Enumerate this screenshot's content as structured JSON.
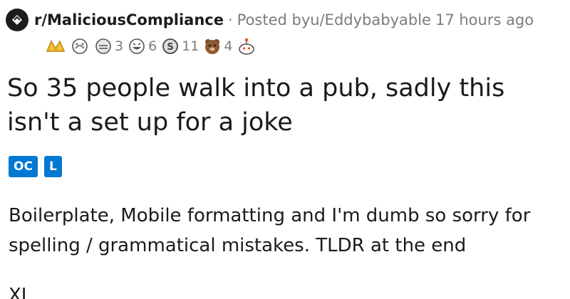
{
  "header": {
    "subreddit": "r/MaliciousCompliance",
    "separator": "·",
    "posted_by": "Posted by ",
    "author": "u/Eddybabyable",
    "time": "17 hours ago"
  },
  "awards": [
    {
      "icon": "gold-wings-award",
      "count": ""
    },
    {
      "icon": "wholesome-hug-award",
      "count": ""
    },
    {
      "icon": "hug-award",
      "count": "3"
    },
    {
      "icon": "laughing-face-award",
      "count": "6"
    },
    {
      "icon": "silver-coin-award",
      "count": "11"
    },
    {
      "icon": "bear-award",
      "count": "4"
    },
    {
      "icon": "snoo-award",
      "count": ""
    }
  ],
  "post": {
    "title": "So 35 people walk into a pub, sadly this isn't a set up for a joke",
    "flairs": [
      "OC",
      "L"
    ],
    "body": "Boilerplate, Mobile formatting and I'm dumb so sorry for spelling / grammatical mistakes. TLDR at the end",
    "body2": "XL"
  },
  "colors": {
    "flair": "#0079d3",
    "meta": "#7c7c7c",
    "text": "#1a1a1b"
  }
}
